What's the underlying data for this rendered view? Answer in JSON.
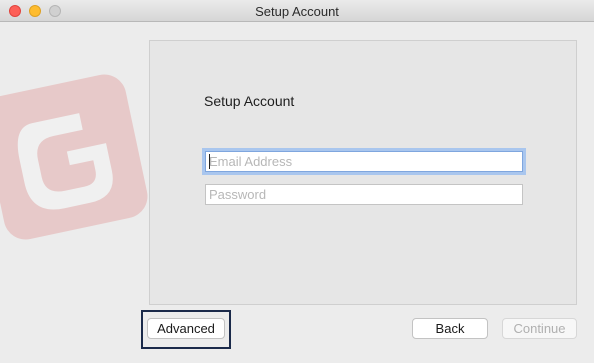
{
  "window": {
    "title": "Setup Account"
  },
  "panel": {
    "heading": "Setup Account",
    "email": {
      "value": "",
      "placeholder": "Email Address"
    },
    "password": {
      "value": "",
      "placeholder": "Password"
    }
  },
  "buttons": {
    "advanced": "Advanced",
    "back": "Back",
    "continue": "Continue"
  },
  "colors": {
    "focus_ring": "#a9c6ee",
    "logo_red": "#d9534f",
    "highlight_border": "#1b2a4a"
  },
  "icons": {
    "logo": "app-logo-icon",
    "close": "close-icon",
    "minimize": "minimize-icon",
    "zoom": "zoom-icon"
  }
}
